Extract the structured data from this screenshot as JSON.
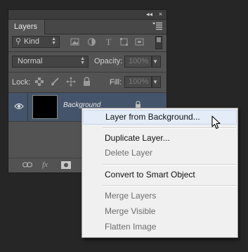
{
  "panel": {
    "tab_label": "Layers",
    "collapse_glyph": "◂◂",
    "close_glyph": "×",
    "filter": {
      "kind_label": "Kind"
    },
    "blend": {
      "mode": "Normal",
      "opacity_label": "Opacity:",
      "opacity_value": "100%"
    },
    "lock": {
      "label": "Lock:",
      "fill_label": "Fill:",
      "fill_value": "100%"
    },
    "layers": [
      {
        "name": "Background",
        "visible": true,
        "locked": true
      }
    ]
  },
  "context_menu": {
    "items": [
      {
        "label": "Layer from Background...",
        "enabled": true,
        "highlighted": true
      },
      {
        "label": "Duplicate Layer...",
        "enabled": true
      },
      {
        "label": "Delete Layer",
        "enabled": false
      },
      {
        "label": "Convert to Smart Object",
        "enabled": true
      },
      {
        "label": "Merge Layers",
        "enabled": false
      },
      {
        "label": "Merge Visible",
        "enabled": false
      },
      {
        "label": "Flatten Image",
        "enabled": false
      }
    ]
  },
  "colors": {
    "panel_bg": "#535353",
    "selected_layer": "#44546a",
    "menu_bg": "#f0f0f0",
    "menu_highlight": "#e3ecf7"
  }
}
